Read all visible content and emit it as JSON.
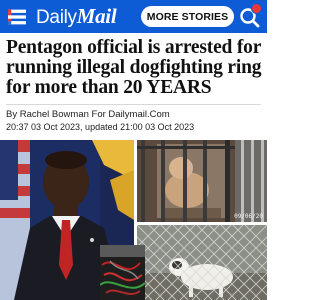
{
  "header": {
    "brand_daily": "Daily",
    "brand_mail": "Mail",
    "more_stories_label": "MORE STORIES",
    "menu_icon": "hamburger-menu-icon",
    "search_icon": "search-icon",
    "brand_color": "#0e5bd6",
    "notification_color": "#e53935"
  },
  "article": {
    "headline": "Pentagon official is arrested for running illegal dogfighting ring for more than 20 YEARS",
    "byline": "By Rachel Bowman For Dailymail.Com",
    "timestamp": "20:37 03 Oct 2023, updated 21:00 03 Oct 2023"
  },
  "images": {
    "kennel_date_stamp": "09/06/20"
  }
}
